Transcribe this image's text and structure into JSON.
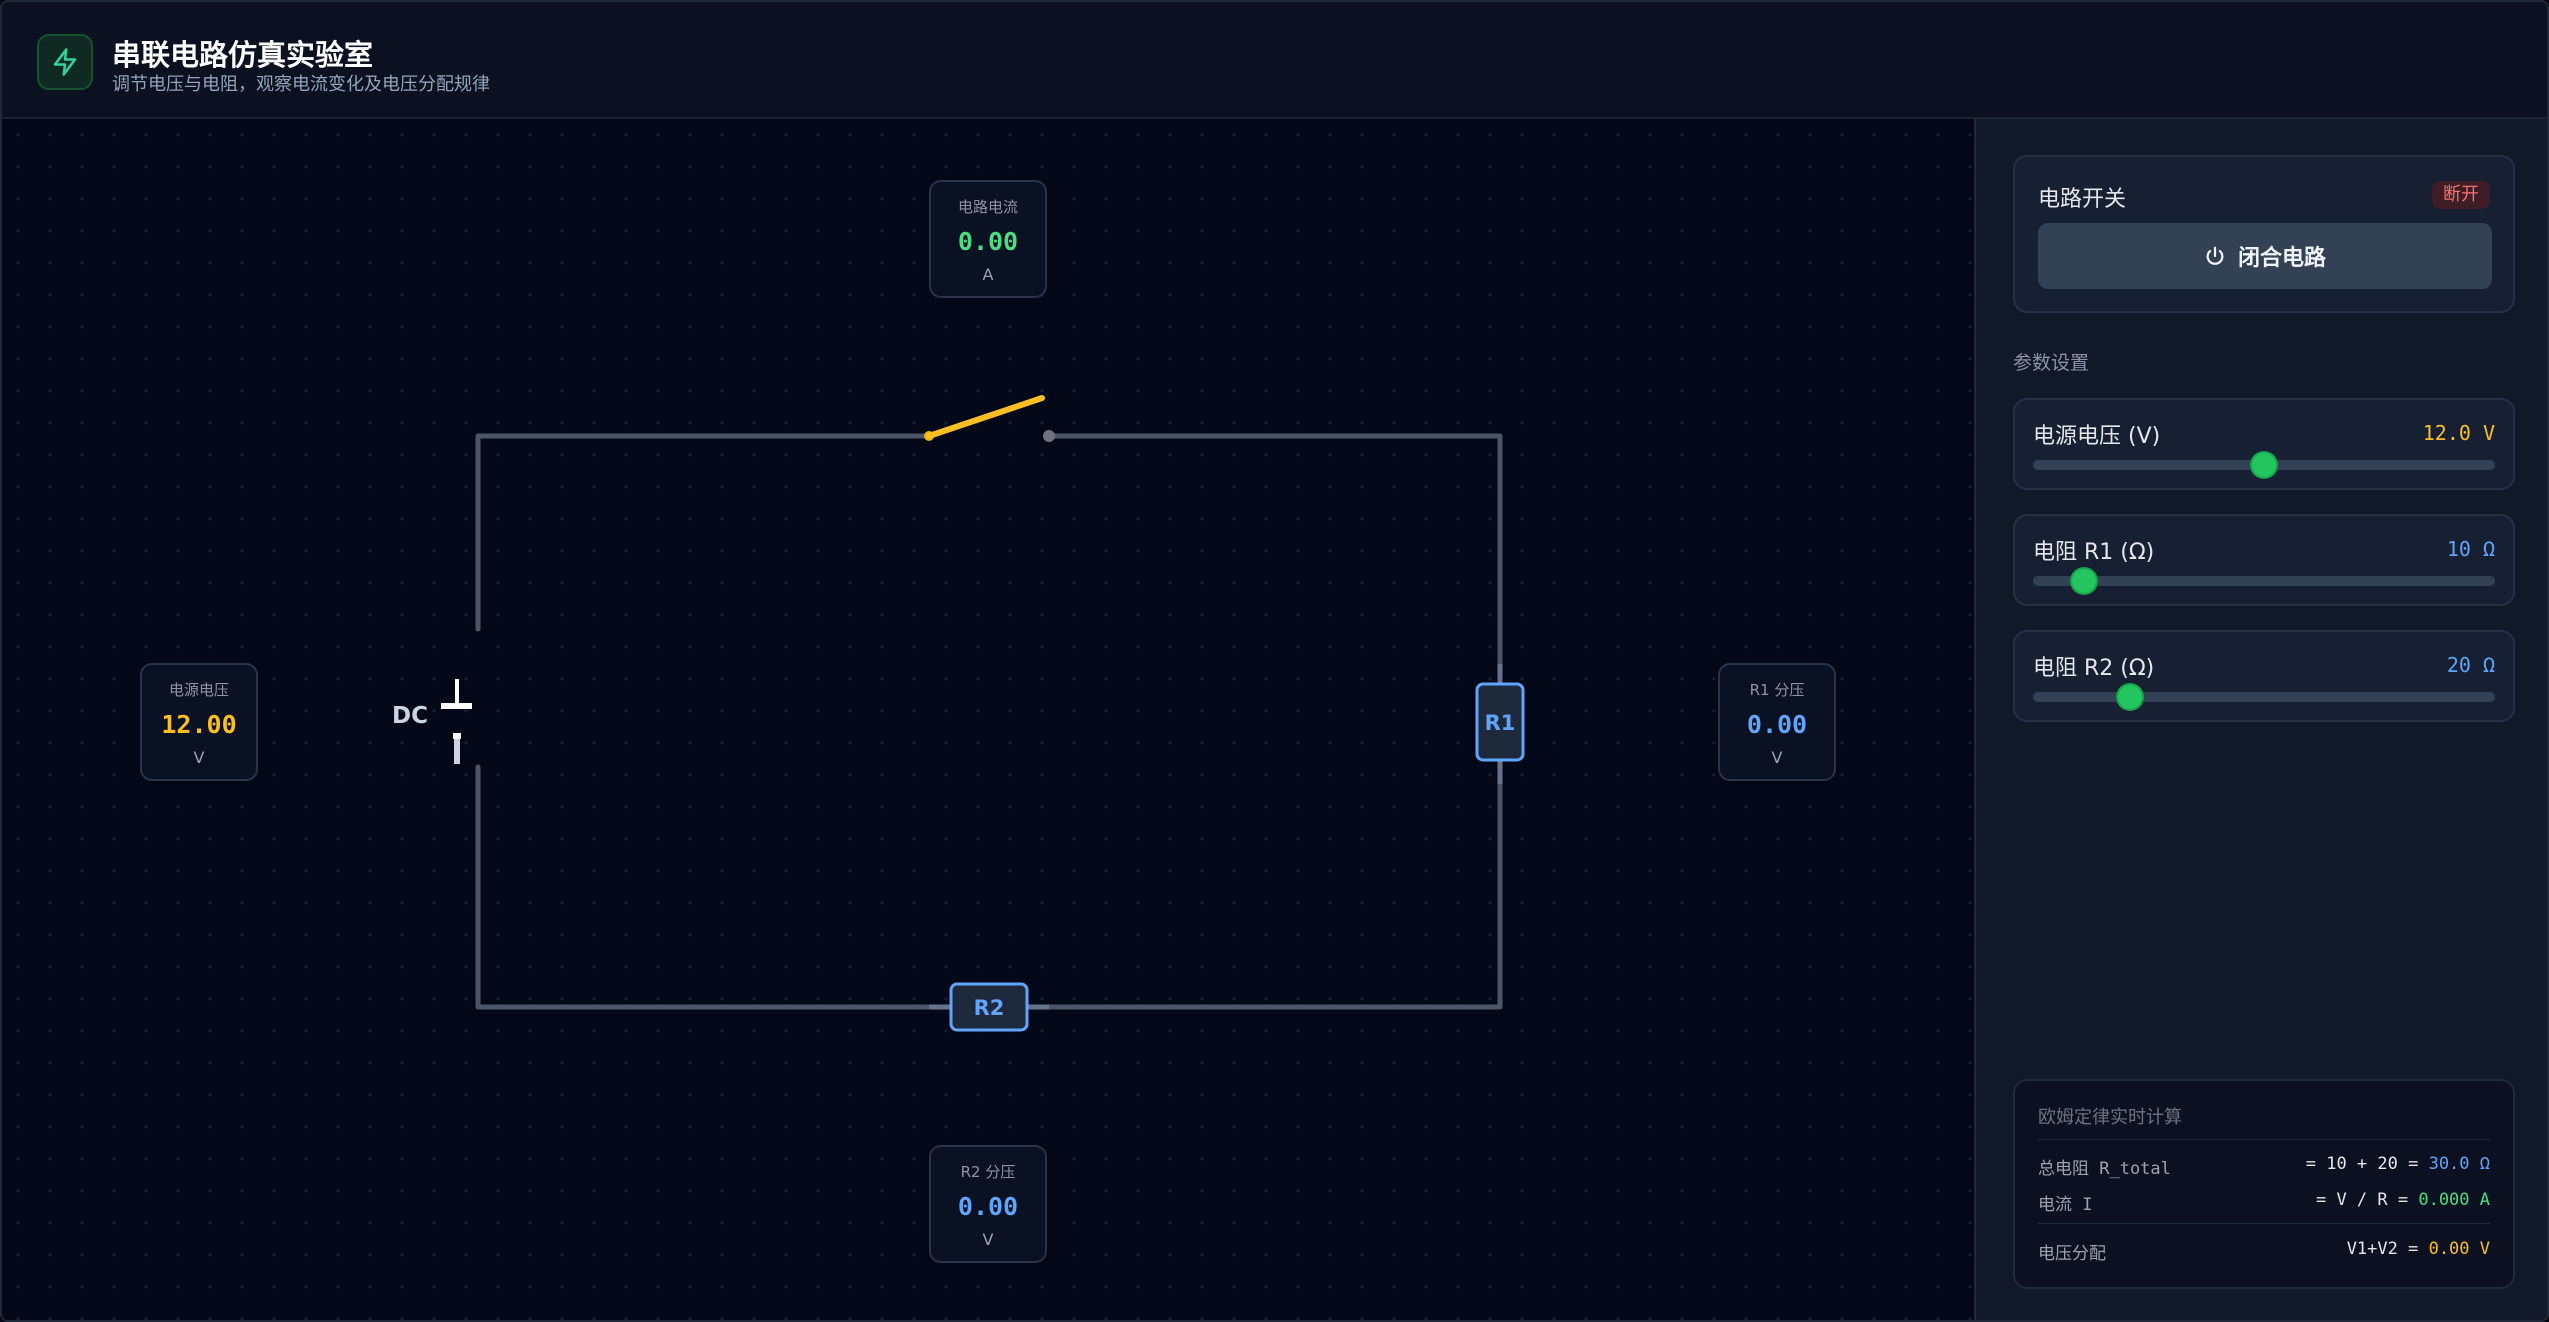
{
  "header": {
    "title": "串联电路仿真实验室",
    "subtitle": "调节电压与电阻，观察电流变化及电压分配规律",
    "logo_icon": "lightning-bolt-icon",
    "accent": "#22c55e"
  },
  "canvas": {
    "battery_label": "DC",
    "r1_label": "R1",
    "r2_label": "R2",
    "switch_state": "open",
    "meters": {
      "current": {
        "label": "电路电流",
        "value": "0.00",
        "unit": "A",
        "color": "#4ade80"
      },
      "source": {
        "label": "电源电压",
        "value": "12.00",
        "unit": "V",
        "color": "#fbbf24"
      },
      "r1": {
        "label": "R1 分压",
        "value": "0.00",
        "unit": "V",
        "color": "#60a5fa"
      },
      "r2": {
        "label": "R2 分压",
        "value": "0.00",
        "unit": "V",
        "color": "#60a5fa"
      }
    }
  },
  "sidebar": {
    "switch": {
      "title": "电路开关",
      "status": "断开",
      "button_label": "闭合电路",
      "button_icon": "power-icon"
    },
    "params_label": "参数设置",
    "params": [
      {
        "label": "电源电压 (V)",
        "value": "12.0 V",
        "color": "#fbbf24",
        "fraction": 0.5
      },
      {
        "label": "电阻 R1 (Ω)",
        "value": "10 Ω",
        "color": "#60a5fa",
        "fraction": 0.11
      },
      {
        "label": "电阻 R2 (Ω)",
        "value": "20 Ω",
        "color": "#60a5fa",
        "fraction": 0.21
      }
    ],
    "calc": {
      "title": "欧姆定律实时计算",
      "rows": [
        {
          "label": "总电阻 R_total",
          "expr": "= 10 + 20 = ",
          "result": "30.0 Ω",
          "color": "#60a5fa"
        },
        {
          "label": "电流 I",
          "expr": "= V / R = ",
          "result": "0.000 A",
          "color": "#4ade80"
        },
        {
          "label": "电压分配",
          "expr": "V1+V2 = ",
          "result": "0.00 V",
          "color": "#fbbf24"
        }
      ]
    }
  }
}
